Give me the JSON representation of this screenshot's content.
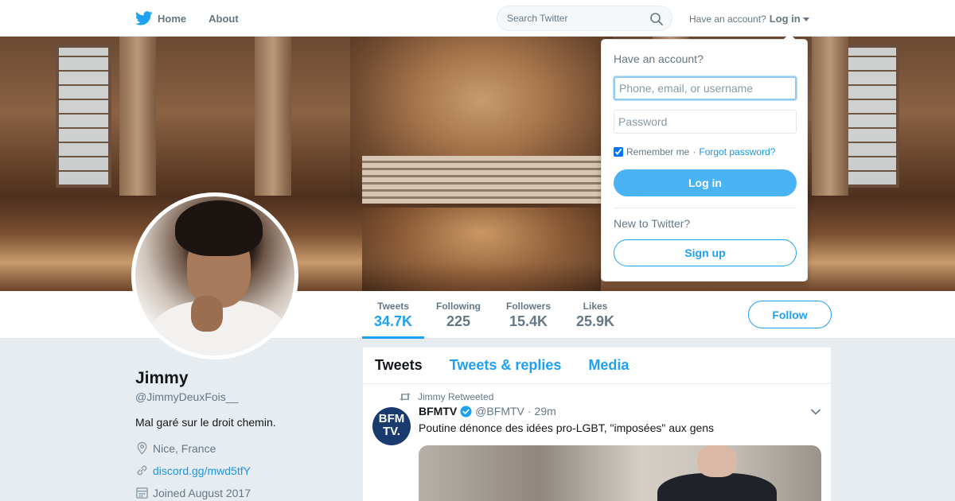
{
  "nav": {
    "home_label": "Home",
    "about_label": "About",
    "search_placeholder": "Search Twitter",
    "have_account": "Have an account?",
    "login_label": "Log in",
    "brand_color": "#1da1f2"
  },
  "profile": {
    "name": "Jimmy",
    "handle": "@JimmyDeuxFois__",
    "bio": "Mal garé sur le droit chemin.",
    "location": "Nice, France",
    "url": "discord.gg/mwd5tfY",
    "joined": "Joined August 2017"
  },
  "stats": [
    {
      "label": "Tweets",
      "value": "34.7K"
    },
    {
      "label": "Following",
      "value": "225"
    },
    {
      "label": "Followers",
      "value": "15.4K"
    },
    {
      "label": "Likes",
      "value": "25.9K"
    }
  ],
  "follow_label": "Follow",
  "timeline": {
    "tabs": [
      "Tweets",
      "Tweets & replies",
      "Media"
    ],
    "tweet": {
      "retweet_context": "Jimmy Retweeted",
      "avatar_text": "BFM TV.",
      "name": "BFMTV",
      "handle": "@BFMTV",
      "time": "29m",
      "text": "Poutine dénonce des idées pro-LGBT, \"imposées\" aux gens"
    }
  },
  "login_dropdown": {
    "title": "Have an account?",
    "username_placeholder": "Phone, email, or username",
    "password_placeholder": "Password",
    "remember_me": "Remember me",
    "separator": "·",
    "forgot_password": "Forgot password?",
    "login_button": "Log in",
    "new_to_twitter": "New to Twitter?",
    "signup_button": "Sign up"
  },
  "icons": {
    "bird": "twitter-bird-icon",
    "search": "search-icon",
    "location": "location-icon",
    "link": "link-icon",
    "calendar": "calendar-icon",
    "retweet": "retweet-icon",
    "verified": "verified-icon",
    "chevron": "chevron-down-icon"
  }
}
